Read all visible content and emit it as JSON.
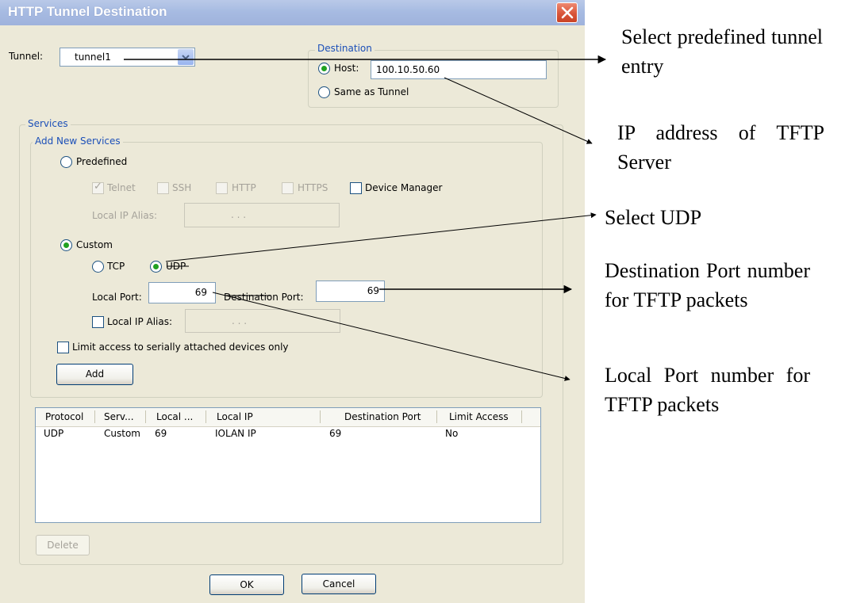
{
  "window": {
    "title": "HTTP Tunnel Destination"
  },
  "tunnel": {
    "label": "Tunnel:",
    "value": "tunnel1"
  },
  "destination": {
    "legend": "Destination",
    "host_label": "Host:",
    "host_value": "100.10.50.60",
    "same_as_tunnel_label": "Same as Tunnel",
    "selected": "host"
  },
  "services": {
    "legend": "Services",
    "add_new_legend": "Add New Services",
    "predefined_label": "Predefined",
    "predefined_options": [
      {
        "label": "Telnet",
        "checked": true,
        "enabled": false
      },
      {
        "label": "SSH",
        "checked": false,
        "enabled": false
      },
      {
        "label": "HTTP",
        "checked": false,
        "enabled": false
      },
      {
        "label": "HTTPS",
        "checked": false,
        "enabled": false
      },
      {
        "label": "Device Manager",
        "checked": false,
        "enabled": true
      }
    ],
    "predefined_local_ip_alias_label": "Local IP Alias:",
    "ip_placeholder": ".        .        .",
    "custom_label": "Custom",
    "mode": "custom",
    "tcp_label": "TCP",
    "udp_label": "UDP",
    "protocol": "UDP",
    "local_port_label": "Local Port:",
    "local_port_value": "69",
    "destination_port_label": "Destination Port:",
    "destination_port_value": "69",
    "custom_local_ip_alias_label": "Local IP Alias:",
    "limit_access_label": "Limit access to serially attached devices only",
    "add_button": "Add"
  },
  "table": {
    "columns": [
      "Protocol",
      "Serv...",
      "Local ...",
      "Local IP",
      "Destination Port",
      "Limit Access"
    ],
    "rows": [
      [
        "UDP",
        "Custom",
        "69",
        "IOLAN IP",
        "69",
        "No"
      ]
    ]
  },
  "buttons": {
    "delete": "Delete",
    "ok": "OK",
    "cancel": "Cancel"
  },
  "annotations": {
    "select_tunnel": "Select predefined tunnel entry",
    "ip_address": "IP address of TFTP Server",
    "select_udp": "Select UDP",
    "destination_port": "Destination Port number for TFTP packets",
    "local_port": "Local Port number for TFTP packets"
  },
  "colors": {
    "title_bar": "#a7bbe2",
    "close_button": "#d9553a",
    "dialog_bg": "#ece9d8",
    "group_label": "#1b4fb8",
    "radio_dot": "#21a121"
  }
}
